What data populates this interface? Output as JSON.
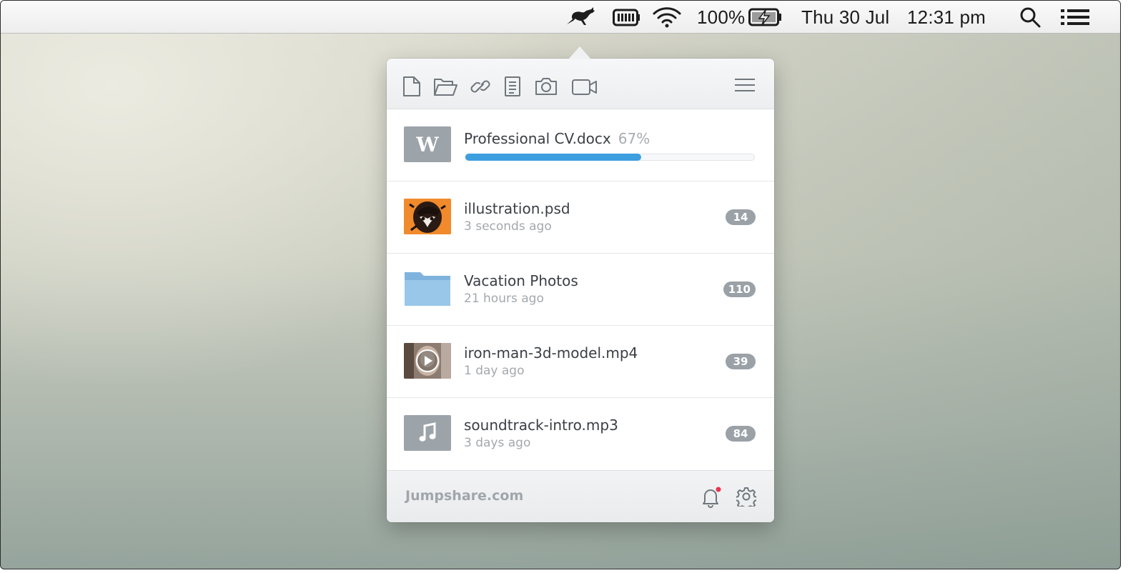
{
  "menubar": {
    "icons": [
      "kangaroo-icon",
      "battery-app-icon",
      "wifi-icon",
      "battery-charging-icon",
      "search-icon",
      "list-icon"
    ],
    "battery_percent": "100%",
    "date": "Thu 30 Jul",
    "time": "12:31 pm"
  },
  "toolbar": {
    "icons": [
      "new-file-icon",
      "open-folder-icon",
      "link-icon",
      "document-icon",
      "camera-icon",
      "video-camera-icon",
      "hamburger-menu-icon"
    ]
  },
  "upload": {
    "thumb_letter": "W",
    "name": "Professional CV.docx",
    "percent_label": "67%",
    "progress": 0.61,
    "accent": "#3d9fe0"
  },
  "files": [
    {
      "name": "illustration.psd",
      "time": "3 seconds ago",
      "count": "14",
      "type": "image"
    },
    {
      "name": "Vacation Photos",
      "time": "21 hours ago",
      "count": "110",
      "type": "folder"
    },
    {
      "name": "iron-man-3d-model.mp4",
      "time": "1 day ago",
      "count": "39",
      "type": "video"
    },
    {
      "name": "soundtrack-intro.mp3",
      "time": "3 days ago",
      "count": "84",
      "type": "audio"
    }
  ],
  "footer": {
    "brand": "Jumpshare.com",
    "notification_dot_color": "#e8344e"
  }
}
